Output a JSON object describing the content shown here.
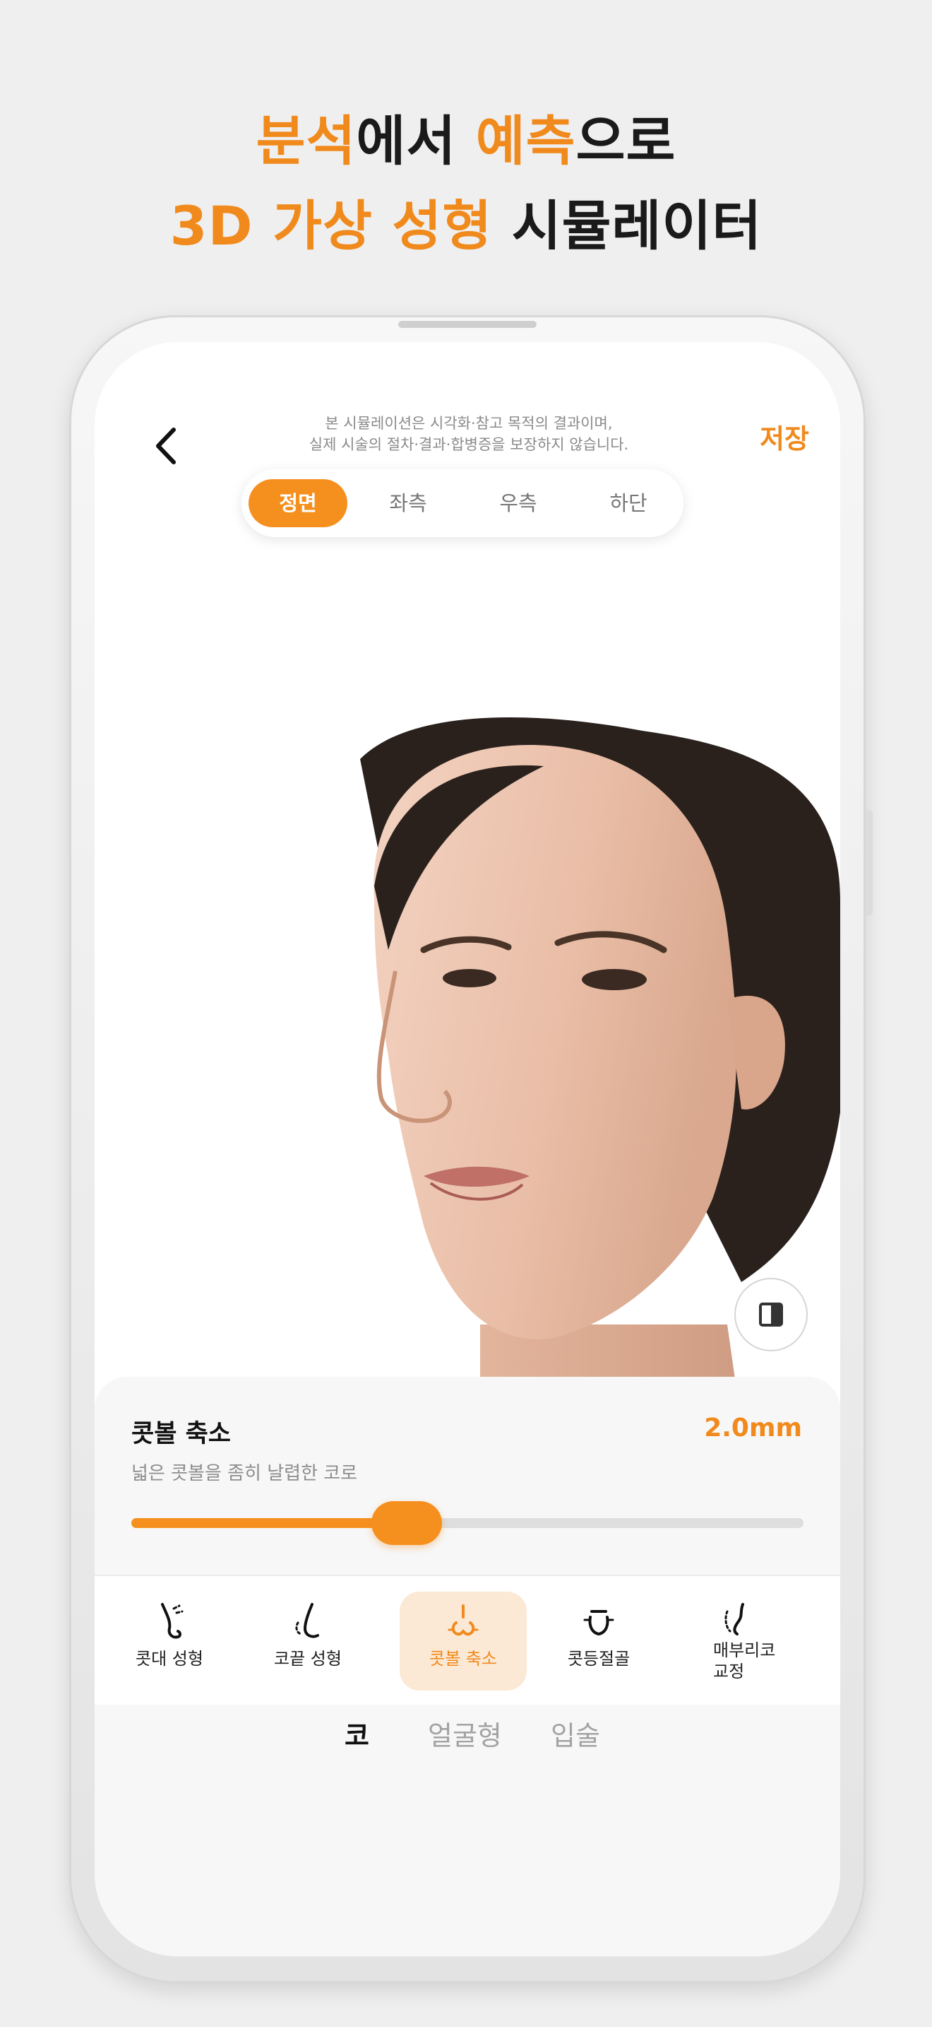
{
  "headline": {
    "line1_highlight_a": "분석",
    "line1_mid": "에서 ",
    "line1_highlight_b": "예측",
    "line1_end": "으로",
    "line2_highlight": "3D 가상 성형",
    "line2_end": " 시뮬레이터"
  },
  "header": {
    "disclaimer_line1": "본 시뮬레이션은 시각화·참고 목적의 결과이며,",
    "disclaimer_line2": "실제 시술의 절차·결과·합병증을 보장하지 않습니다.",
    "save_label": "저장"
  },
  "view_tabs": [
    {
      "label": "정면",
      "active": true
    },
    {
      "label": "좌측",
      "active": false
    },
    {
      "label": "우측",
      "active": false
    },
    {
      "label": "하단",
      "active": false
    }
  ],
  "adjustment": {
    "title": "콧볼 축소",
    "value": "2.0mm",
    "description": "넓은 콧볼을 좀히 날렵한 코로",
    "slider_fraction": 0.41
  },
  "tools": [
    {
      "label": "콧대 성형",
      "icon": "nose-bridge-icon",
      "active": false
    },
    {
      "label": "코끝 성형",
      "icon": "nose-tip-icon",
      "active": false
    },
    {
      "label": "콧볼 축소",
      "icon": "nostril-reduction-icon",
      "active": true
    },
    {
      "label": "콧등절골",
      "icon": "nose-bone-icon",
      "active": false
    },
    {
      "label": "매부리코\n교정",
      "label_line1": "매부리코",
      "label_line2": "교정",
      "icon": "hump-nose-icon",
      "active": false
    }
  ],
  "categories": [
    {
      "label": "코",
      "active": true
    },
    {
      "label": "얼굴형",
      "active": false
    },
    {
      "label": "입술",
      "active": false
    }
  ],
  "colors": {
    "accent": "#f08a1c",
    "accent_light": "#fbe9d6",
    "text": "#111111"
  }
}
